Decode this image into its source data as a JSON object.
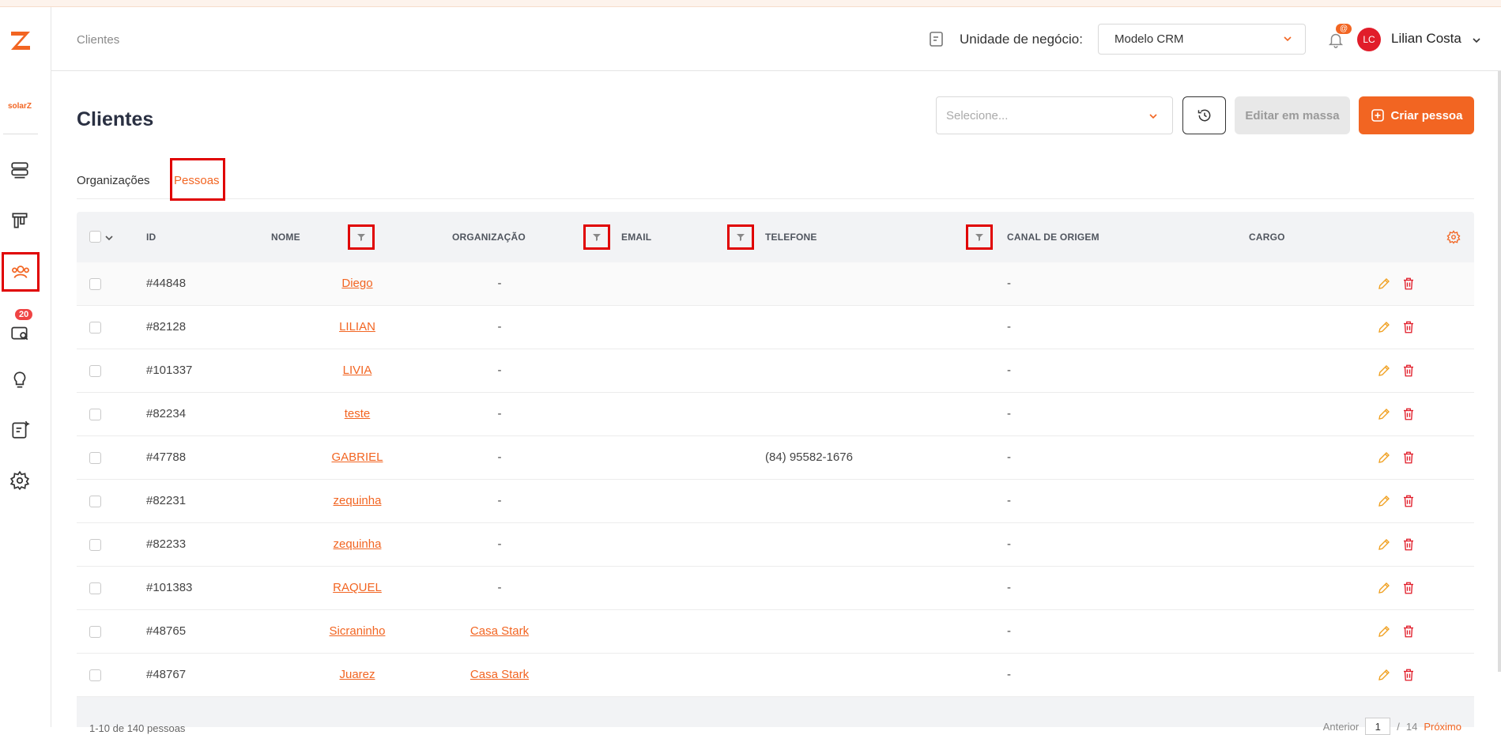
{
  "sidebar": {
    "brand": "solarZ",
    "badge": "20",
    "items": [
      {
        "name": "server-icon"
      },
      {
        "name": "kanban-icon"
      },
      {
        "name": "users-icon"
      },
      {
        "name": "search-wallet-icon"
      },
      {
        "name": "lightbulb-icon"
      },
      {
        "name": "document-sparkle-icon"
      },
      {
        "name": "settings-icon"
      }
    ]
  },
  "header": {
    "breadcrumb": "Clientes",
    "business_unit_label": "Unidade de negócio:",
    "business_unit_value": "Modelo CRM",
    "notification_badge": "@",
    "avatar_initials": "LC",
    "user_name": "Lilian Costa"
  },
  "main": {
    "title": "Clientes",
    "select_placeholder": "Selecione...",
    "edit_bulk_label": "Editar em massa",
    "create_label": "Criar pessoa",
    "tabs": [
      {
        "label": "Organizações"
      },
      {
        "label": "Pessoas"
      }
    ]
  },
  "table": {
    "columns": {
      "id": "ID",
      "nome": "NOME",
      "organizacao": "ORGANIZAÇÃO",
      "email": "EMAIL",
      "telefone": "TELEFONE",
      "canal": "CANAL DE ORIGEM",
      "cargo": "CARGO"
    },
    "rows": [
      {
        "id": "#44848",
        "nome": "Diego",
        "org": "-",
        "email": "",
        "tel": "",
        "canal": "-"
      },
      {
        "id": "#82128",
        "nome": "LILIAN",
        "org": "-",
        "email": "",
        "tel": "",
        "canal": "-"
      },
      {
        "id": "#101337",
        "nome": "LIVIA",
        "org": "-",
        "email": "",
        "tel": "",
        "canal": "-"
      },
      {
        "id": "#82234",
        "nome": "teste",
        "org": "-",
        "email": "",
        "tel": "",
        "canal": "-"
      },
      {
        "id": "#47788",
        "nome": "GABRIEL",
        "org": "-",
        "email": "",
        "tel": "(84) 95582-1676",
        "canal": "-"
      },
      {
        "id": "#82231",
        "nome": "zequinha",
        "org": "-",
        "email": "",
        "tel": "",
        "canal": "-"
      },
      {
        "id": "#82233",
        "nome": "zequinha",
        "org": "-",
        "email": "",
        "tel": "",
        "canal": "-"
      },
      {
        "id": "#101383",
        "nome": "RAQUEL",
        "org": "-",
        "email": "",
        "tel": "",
        "canal": "-"
      },
      {
        "id": "#48765",
        "nome": "Sicraninho",
        "org": "Casa Stark",
        "email": "",
        "tel": "",
        "canal": "-"
      },
      {
        "id": "#48767",
        "nome": "Juarez",
        "org": "Casa Stark",
        "email": "",
        "tel": "",
        "canal": "-"
      }
    ],
    "footer_count": "1-10 de 140 pessoas",
    "pager_prev": "Anterior",
    "pager_page": "1",
    "pager_sep": "/",
    "pager_total": "14",
    "pager_next": "Próximo"
  },
  "colors": {
    "accent": "#f26522",
    "highlight": "#e00000",
    "danger": "#e11d2a",
    "edit_icon": "#f0a020"
  }
}
